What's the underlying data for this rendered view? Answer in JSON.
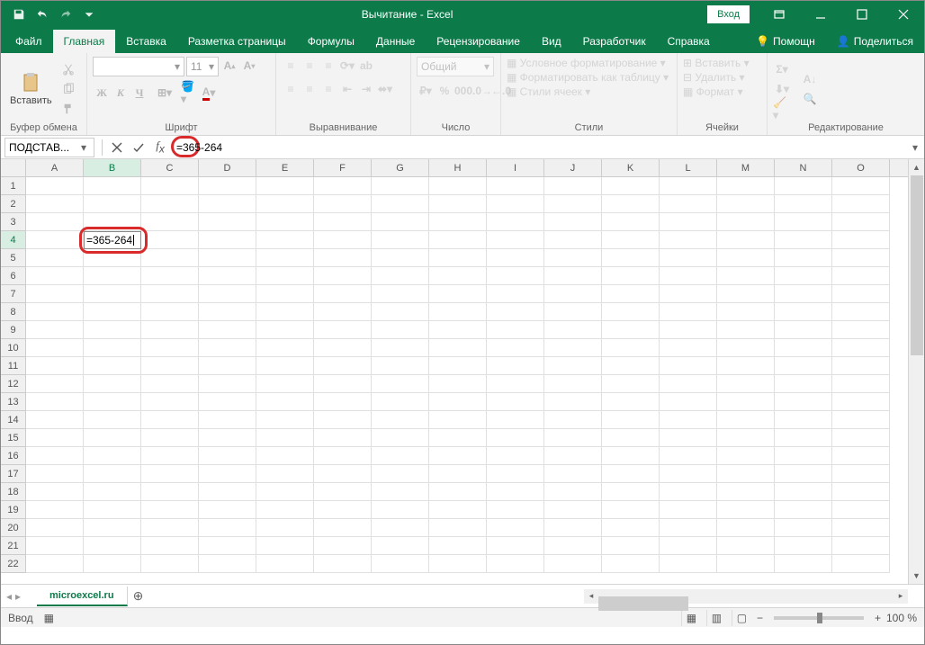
{
  "titlebar": {
    "title": "Вычитание - Excel",
    "login": "Вход"
  },
  "tabs": {
    "file": "Файл",
    "home": "Главная",
    "insert": "Вставка",
    "layout": "Разметка страницы",
    "formulas": "Формулы",
    "data": "Данные",
    "review": "Рецензирование",
    "view": "Вид",
    "developer": "Разработчик",
    "help": "Справка",
    "tellme": "Помощн",
    "share": "Поделиться"
  },
  "ribbon": {
    "clipboard_label": "Буфер обмена",
    "paste": "Вставить",
    "font_label": "Шрифт",
    "font_name": "",
    "font_size": "11",
    "alignment_label": "Выравнивание",
    "number_label": "Число",
    "number_format": "Общий",
    "styles_label": "Стили",
    "cond_fmt": "Условное форматирование",
    "as_table": "Форматировать как таблицу",
    "cell_styles": "Стили ячеек",
    "cells_label": "Ячейки",
    "insert_btn": "Вставить",
    "delete_btn": "Удалить",
    "format_btn": "Формат",
    "editing_label": "Редактирование"
  },
  "formula_bar": {
    "name_box": "ПОДСТАВ...",
    "formula": "=365-264"
  },
  "grid": {
    "columns": [
      "A",
      "B",
      "C",
      "D",
      "E",
      "F",
      "G",
      "H",
      "I",
      "J",
      "K",
      "L",
      "M",
      "N",
      "O"
    ],
    "rows": [
      "1",
      "2",
      "3",
      "4",
      "5",
      "6",
      "7",
      "8",
      "9",
      "10",
      "11",
      "12",
      "13",
      "14",
      "15",
      "16",
      "17",
      "18",
      "19",
      "20",
      "21",
      "22"
    ],
    "active_cell_value": "=365-264",
    "active_col": "B",
    "active_row": "4"
  },
  "sheet": {
    "name": "microexcel.ru"
  },
  "status": {
    "mode": "Ввод",
    "zoom": "100 %"
  }
}
